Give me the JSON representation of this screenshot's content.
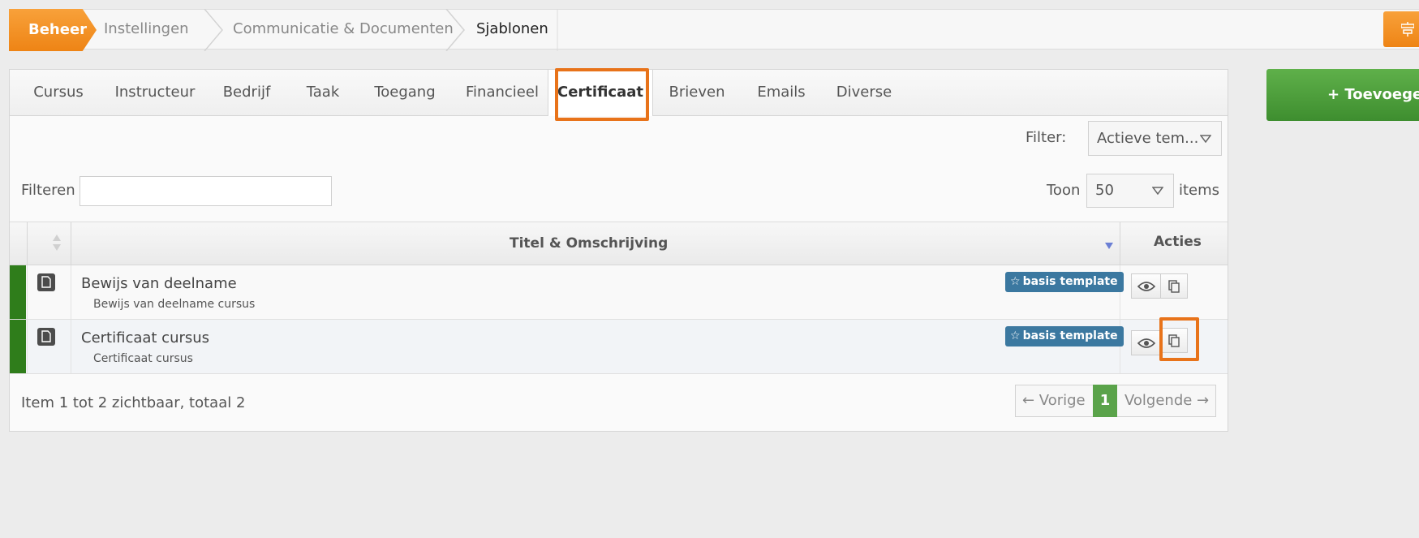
{
  "breadcrumb": {
    "items": [
      "Beheer",
      "Instellingen",
      "Communicatie & Documenten",
      "Sjablonen"
    ]
  },
  "tabs": [
    "Cursus",
    "Instructeur",
    "Bedrijf",
    "Taak",
    "Toegang",
    "Financieel",
    "Certificaat",
    "Brieven",
    "Emails",
    "Diverse"
  ],
  "active_tab": "Certificaat",
  "filter": {
    "label": "Filter:",
    "value": "Actieve tem..."
  },
  "search": {
    "label": "Filteren",
    "value": ""
  },
  "page_size": {
    "prefix": "Toon",
    "value": "50",
    "suffix": "items"
  },
  "table": {
    "headers": [
      "Titel & Omschrijving",
      "Acties"
    ],
    "rows": [
      {
        "title": "Bewijs van deelname",
        "description": "Bewijs van deelname cursus",
        "badge": "basis template"
      },
      {
        "title": "Certificaat cursus",
        "description": "Certificaat cursus",
        "badge": "basis template"
      }
    ]
  },
  "footer": {
    "summary": "Item 1 tot 2 zichtbaar, totaal 2",
    "prev": "← Vorige",
    "page": "1",
    "next": "Volgende →"
  },
  "add_button": "+ Toevoegen",
  "colors": {
    "accent_orange": "#ee8415",
    "highlight_orange": "#e8731a",
    "status_green": "#2f7d1b",
    "badge_blue": "#3b78a0",
    "add_green": "#4ea23d"
  },
  "icons": [
    "file-icon",
    "eye-icon",
    "copy-icon",
    "star-icon",
    "caret-down-icon",
    "sort-icon",
    "toolbar-icon"
  ]
}
